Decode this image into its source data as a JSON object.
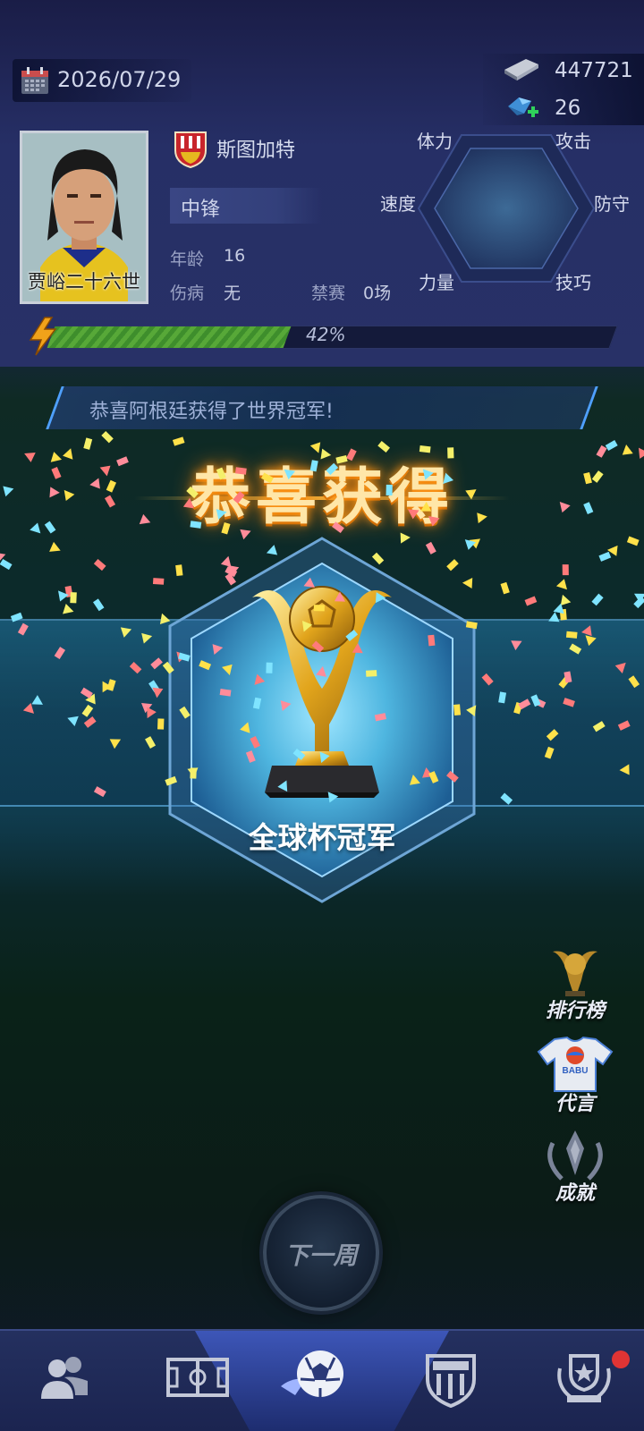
{
  "header": {
    "date": "2026/07/29",
    "cash": "447721",
    "gems": "26"
  },
  "player": {
    "name": "贾峪二十六世",
    "club": "斯图加特",
    "position": "中锋",
    "age_label": "年龄",
    "age_value": "16",
    "injury_label": "伤病",
    "injury_value": "无",
    "ban_label": "禁赛",
    "ban_value": "0场",
    "energy_percent": 42,
    "energy_text": "42%"
  },
  "stats": {
    "stamina": "体力",
    "attack": "攻击",
    "speed": "速度",
    "defense": "防守",
    "strength": "力量",
    "skill": "技巧"
  },
  "news": {
    "text": "恭喜阿根廷获得了世界冠军!"
  },
  "award": {
    "title": "恭喜获得",
    "trophy_name": "全球杯冠军"
  },
  "side_menu": {
    "leaderboard": "排行榜",
    "endorsement": "代言",
    "endorsement_jersey_text": "BABU",
    "achievement": "成就"
  },
  "actions": {
    "next_week": "下一周"
  },
  "bottom_nav": {
    "items": [
      "team",
      "pitch",
      "match",
      "club",
      "trophy"
    ],
    "active": "match",
    "trophy_badge": true
  },
  "colors": {
    "header_bg": "#262f66",
    "energy_fill": "#57a838",
    "title_glow": "#ff9a1a",
    "nav_active": "#3d56b8",
    "badge": "#e03434"
  }
}
